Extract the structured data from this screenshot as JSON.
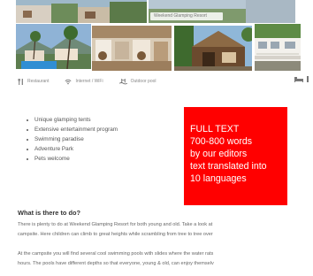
{
  "gallery": {
    "caption": "Weekend Glamping Resort",
    "photos": [
      {
        "name": "houses-top",
        "desc": "houses"
      },
      {
        "name": "palm-villas",
        "desc": "villas"
      },
      {
        "name": "pool",
        "desc": "pool"
      },
      {
        "name": "dining-terrace",
        "desc": "terrace"
      },
      {
        "name": "tent-lodge",
        "desc": "lodge"
      },
      {
        "name": "mobile-home",
        "desc": "home"
      }
    ]
  },
  "amenities": [
    {
      "label": "Restaurant",
      "icon": "cutlery-icon"
    },
    {
      "label": "Internet / WiFi",
      "icon": "wifi-icon"
    },
    {
      "label": "Outdoor pool",
      "icon": "pool-icon"
    }
  ],
  "features": [
    "Unique glamping tents",
    "Extensive entertainment program",
    "Swimming paradise",
    "Adventure Park",
    "Pets welcome"
  ],
  "placeholder_box": {
    "lines": [
      "FULL TEXT",
      "700-800 words",
      "by our editors",
      "text translated into",
      "10 languages"
    ],
    "color": "#ff0000"
  },
  "section": {
    "heading": "What is there to do?",
    "para1": [
      "There is plenty to do at Weekend Glamping Resort for both young and old. Take a look at",
      "campsite. Here children can climb to great heights while scrambling from tree to tree over"
    ],
    "para2": [
      "At the campsite you will find several cool swimming pools with slides where the water rats",
      "hours. The pools have different depths so that everyone, young & old, can enjoy themselv"
    ]
  }
}
